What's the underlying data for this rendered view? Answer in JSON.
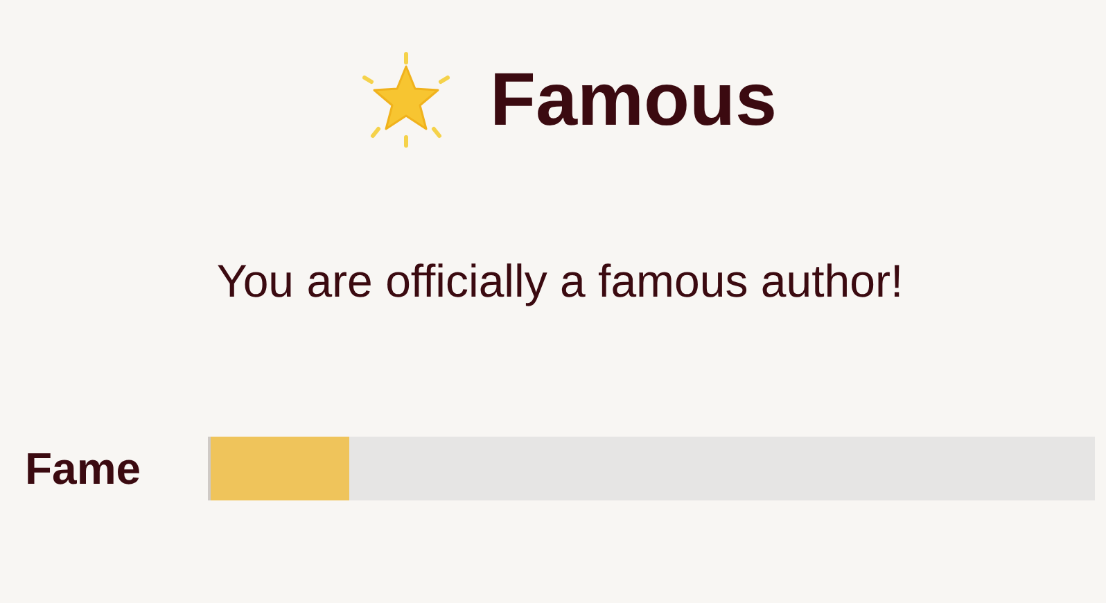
{
  "title": "Famous",
  "message": "You are officially a famous author!",
  "meter": {
    "label": "Fame",
    "level": 0.156
  }
}
